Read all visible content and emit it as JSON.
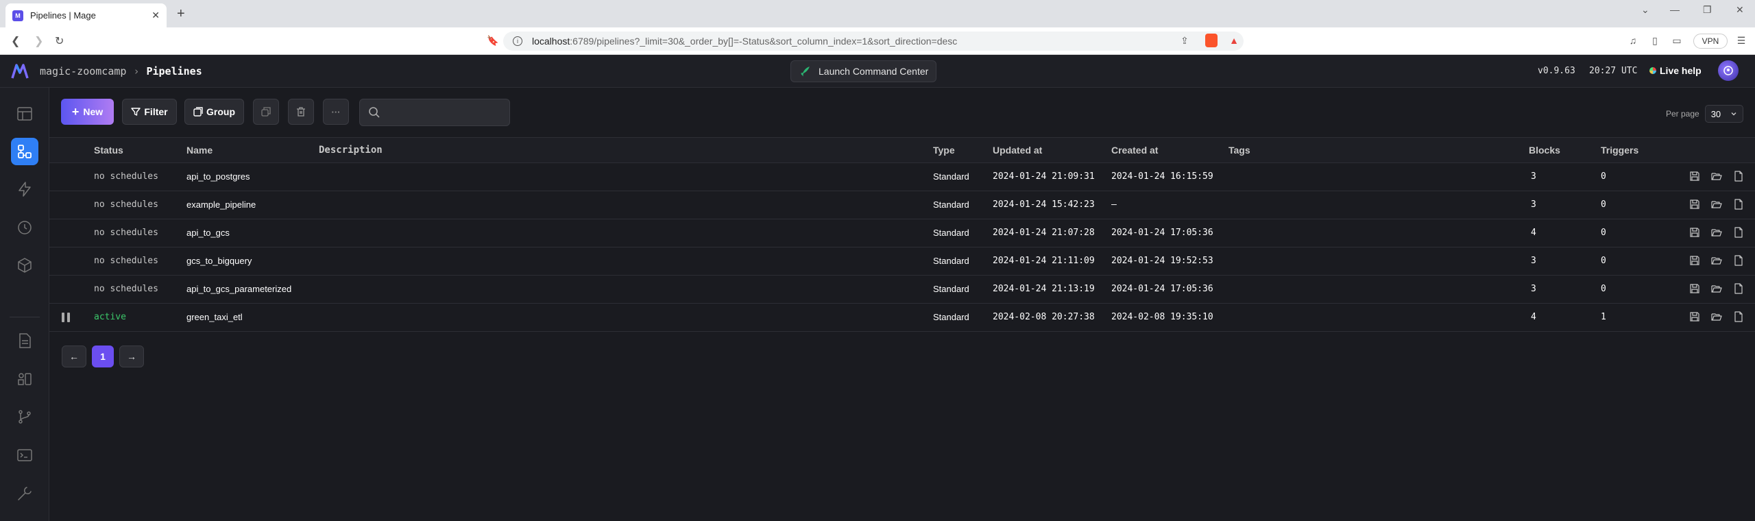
{
  "browser": {
    "tab_title": "Pipelines | Mage",
    "favicon": "M",
    "url_host": "localhost",
    "url_rest": ":6789/pipelines?_limit=30&_order_by[]=-Status&sort_column_index=1&sort_direction=desc",
    "vpn_label": "VPN"
  },
  "header": {
    "project": "magic-zoomcamp",
    "separator": "›",
    "page": "Pipelines",
    "launch_label": "Launch Command Center",
    "version": "v0.9.63",
    "time": "20:27 UTC",
    "help_label": "Live help"
  },
  "toolbar": {
    "new_label": "New",
    "filter_label": "Filter",
    "group_label": "Group",
    "more_label": "···",
    "search_placeholder": "",
    "per_page_label": "Per page",
    "per_page_value": "30"
  },
  "table": {
    "columns": [
      "Status",
      "Name",
      "Description",
      "Type",
      "Updated at",
      "Created at",
      "Tags",
      "Blocks",
      "Triggers"
    ],
    "rows": [
      {
        "status": "no schedules",
        "name": "api_to_postgres",
        "description": "",
        "type": "Standard",
        "updated": "2024-01-24 21:09:31",
        "created": "2024-01-24 16:15:59",
        "tags": "",
        "blocks": "3",
        "triggers": "0"
      },
      {
        "status": "no schedules",
        "name": "example_pipeline",
        "description": "",
        "type": "Standard",
        "updated": "2024-01-24 15:42:23",
        "created": "—",
        "tags": "",
        "blocks": "3",
        "triggers": "0"
      },
      {
        "status": "no schedules",
        "name": "api_to_gcs",
        "description": "",
        "type": "Standard",
        "updated": "2024-01-24 21:07:28",
        "created": "2024-01-24 17:05:36",
        "tags": "",
        "blocks": "4",
        "triggers": "0"
      },
      {
        "status": "no schedules",
        "name": "gcs_to_bigquery",
        "description": "",
        "type": "Standard",
        "updated": "2024-01-24 21:11:09",
        "created": "2024-01-24 19:52:53",
        "tags": "",
        "blocks": "3",
        "triggers": "0"
      },
      {
        "status": "no schedules",
        "name": "api_to_gcs_parameterized",
        "description": "",
        "type": "Standard",
        "updated": "2024-01-24 21:13:19",
        "created": "2024-01-24 17:05:36",
        "tags": "",
        "blocks": "3",
        "triggers": "0"
      },
      {
        "status": "active",
        "name": "green_taxi_etl",
        "description": "",
        "type": "Standard",
        "updated": "2024-02-08 20:27:38",
        "created": "2024-02-08 19:35:10",
        "tags": "",
        "blocks": "4",
        "triggers": "1"
      }
    ]
  },
  "pagination": {
    "prev": "←",
    "current": "1",
    "next": "→"
  },
  "colors": {
    "accent": "#2f7ff5",
    "active_status": "#3cc86a",
    "page_current": "#6b4ef0"
  },
  "sidebar": {
    "icons": [
      "dashboard-icon",
      "pipelines-icon",
      "triggers-icon",
      "schedule-icon",
      "blocks-icon",
      "files-icon",
      "templates-icon",
      "version-control-icon",
      "terminal-icon",
      "settings-icon"
    ]
  }
}
